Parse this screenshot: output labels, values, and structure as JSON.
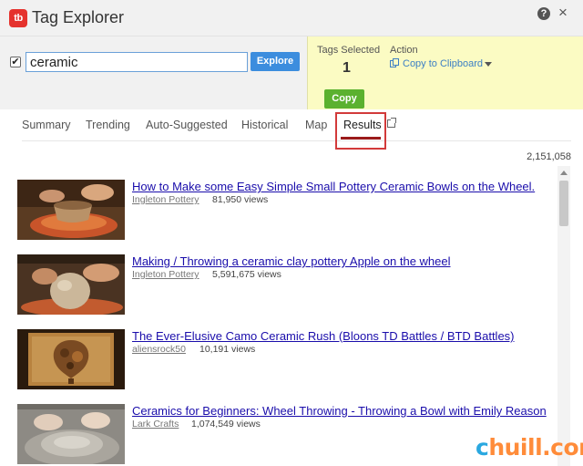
{
  "app": {
    "title": "Tag Explorer",
    "logo_text": "tb",
    "help_icon": "?",
    "close_icon": "×"
  },
  "search": {
    "checked": true,
    "checkbox_mark": "✔",
    "value": "ceramic",
    "explore_label": "Explore"
  },
  "panel": {
    "tags_selected_label": "Tags Selected",
    "tags_selected_value": "1",
    "action_label": "Action",
    "action_value": "Copy to Clipboard",
    "copy_label": "Copy"
  },
  "tabs": [
    {
      "label": "Summary"
    },
    {
      "label": "Trending"
    },
    {
      "label": "Auto-Suggested"
    },
    {
      "label": "Historical"
    },
    {
      "label": "Map"
    },
    {
      "label": "Results",
      "active": true
    }
  ],
  "results_count": "2,151,058",
  "results": [
    {
      "title": "How to Make some Easy Simple Small Pottery Ceramic Bowls on the Wheel.",
      "channel": "Ingleton Pottery",
      "views": "81,950 views"
    },
    {
      "title": "Making / Throwing a ceramic clay pottery Apple on the wheel",
      "channel": "Ingleton Pottery",
      "views": "5,591,675 views"
    },
    {
      "title": "The Ever-Elusive Camo Ceramic Rush (Bloons TD Battles / BTD Battles)",
      "channel": "aliensrock50",
      "views": "10,191 views"
    },
    {
      "title": "Ceramics for Beginners: Wheel Throwing - Throwing a Bowl with Emily Reason",
      "channel": "Lark Crafts",
      "views": "1,074,549 views"
    }
  ],
  "watermark": {
    "part1": "c",
    "part2": "huill.com"
  },
  "colors": {
    "accent": "#3c8dde",
    "copy_green": "#5bb12f",
    "panel_yellow": "#fbfbc3",
    "highlight_red": "#d23a3a",
    "link": "#1a0dab"
  }
}
